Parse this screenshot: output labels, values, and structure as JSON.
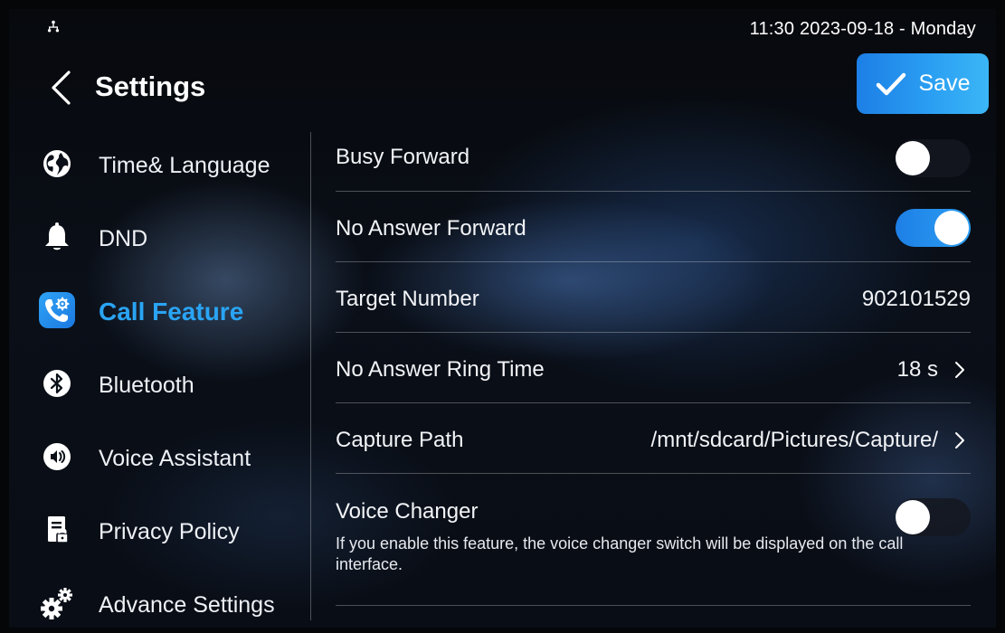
{
  "status": {
    "clock": "11:30  2023-09-18 - Monday",
    "network_icon": "network-icon"
  },
  "header": {
    "back_icon": "chevron-left-icon",
    "title": "Settings",
    "save_label": "Save",
    "save_icon": "check-icon"
  },
  "colors": {
    "accent": "#2aa4f4",
    "save_gradient_start": "#1d7fe6",
    "save_gradient_end": "#3bb6f6",
    "divider": "rgba(255,255,255,0.28)"
  },
  "sidebar": {
    "items": [
      {
        "label": "Time& Language",
        "icon": "globe-icon",
        "active": false
      },
      {
        "label": "DND",
        "icon": "bell-icon",
        "active": false
      },
      {
        "label": "Call Feature",
        "icon": "phone-gear-icon",
        "active": true
      },
      {
        "label": "Bluetooth",
        "icon": "bluetooth-icon",
        "active": false
      },
      {
        "label": "Voice Assistant",
        "icon": "speaker-icon",
        "active": false
      },
      {
        "label": "Privacy Policy",
        "icon": "document-lock-icon",
        "active": false
      },
      {
        "label": "Advance Settings",
        "icon": "gears-icon",
        "active": false
      }
    ]
  },
  "settings": {
    "busy_forward": {
      "label": "Busy Forward",
      "enabled": false
    },
    "no_answer_forward": {
      "label": "No Answer Forward",
      "enabled": true
    },
    "target_number": {
      "label": "Target Number",
      "value": "902101529"
    },
    "ring_time": {
      "label": "No Answer Ring Time",
      "value": "18 s"
    },
    "capture_path": {
      "label": "Capture Path",
      "value": "/mnt/sdcard/Pictures/Capture/"
    },
    "voice_changer": {
      "label": "Voice Changer",
      "enabled": false,
      "description": "If you enable this feature, the voice changer switch will be displayed on the call interface."
    }
  }
}
